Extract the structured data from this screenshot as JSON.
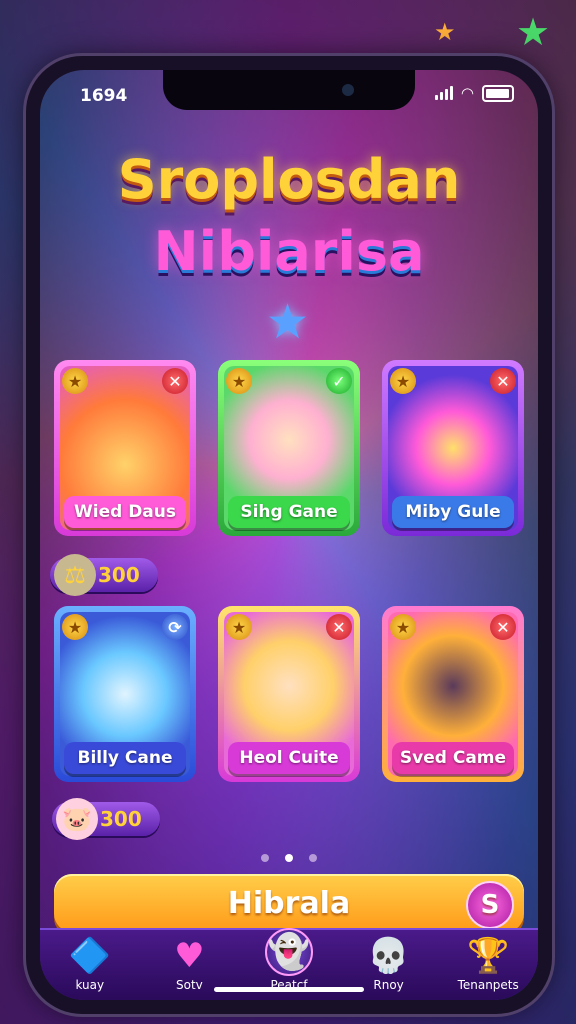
{
  "status_bar": {
    "time": "1694"
  },
  "title": {
    "line1": "Sroplosdan",
    "line2": "Nibiarisa"
  },
  "games": [
    {
      "label": "Wied Daus",
      "badge": "close",
      "color": "#ff5ad8"
    },
    {
      "label": "Sihg Gane",
      "badge": "check",
      "color": "#3ad84a"
    },
    {
      "label": "Miby Gule",
      "badge": "close",
      "color": "#3a7ae8"
    },
    {
      "label": "Billy Cane",
      "badge": "alt",
      "color": "#3a4ad8"
    },
    {
      "label": "Heol Cuite",
      "badge": "close",
      "color": "#d83ad8"
    },
    {
      "label": "Sved Came",
      "badge": "close",
      "color": "#e83aa8"
    }
  ],
  "coins": [
    {
      "value": "300",
      "icon": "dumbbell-icon"
    },
    {
      "value": "300",
      "icon": "piggy-icon"
    }
  ],
  "cta": {
    "label": "Hibrala",
    "coin_glyph": "S"
  },
  "tabs": [
    {
      "label": "kuay",
      "icon": "shapes-icon"
    },
    {
      "label": "Sotv",
      "icon": "heart-icon"
    },
    {
      "label": "Peatcf",
      "icon": "ghost-icon",
      "active": true
    },
    {
      "label": "Rnoy",
      "icon": "skull-icon"
    },
    {
      "label": "Tenanpets",
      "icon": "trophy-icon"
    }
  ]
}
